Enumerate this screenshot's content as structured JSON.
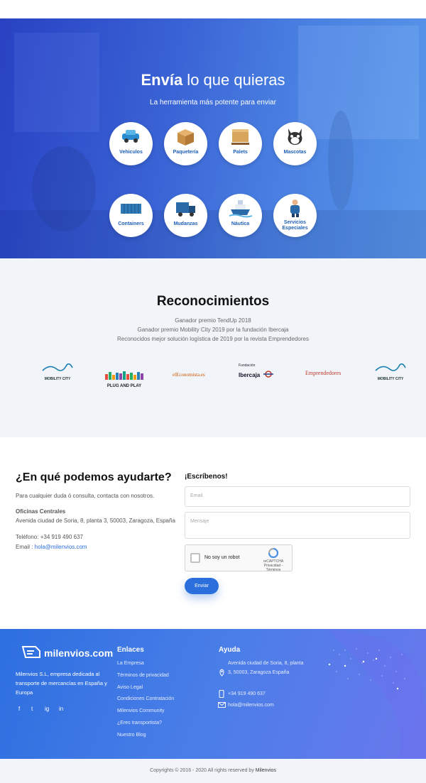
{
  "hero": {
    "title_bold": "Envía",
    "title_rest": " lo que quieras",
    "subtitle": "La herramienta más potente para enviar",
    "categories": [
      {
        "label": "Vehiculos",
        "icon": "car-icon"
      },
      {
        "label": "Paquetería",
        "icon": "box-icon"
      },
      {
        "label": "Palets",
        "icon": "pallet-icon"
      },
      {
        "label": "Mascotas",
        "icon": "cat-icon"
      },
      {
        "label": "Containers",
        "icon": "container-icon"
      },
      {
        "label": "Mudanzas",
        "icon": "truck-icon"
      },
      {
        "label": "Náutica",
        "icon": "ship-icon"
      },
      {
        "label": "Servicios Especiales",
        "icon": "worker-icon"
      }
    ]
  },
  "recognitions": {
    "title": "Reconocimientos",
    "lines": [
      "Ganador premio TendUp 2018",
      "Ganador premio Mobility City 2019 por la fundación Ibercaja",
      "Reconocidos mejor solución logística de 2019 por la revista Emprendedores"
    ],
    "logos": {
      "mobility": "MOBILITY CITY",
      "plugandplay": "PLUG AND PLAY",
      "economista": "elEconomista.es",
      "ibercaja_top": "Fundación",
      "ibercaja_bottom": "Ibercaja",
      "emprendedores": "Emprendedores"
    }
  },
  "contact": {
    "title": "¿En qué podemos ayudarte?",
    "intro": "Para cualquier duda ó consulta, contacta con nosotros.",
    "office_label": "Oficinas Centrales",
    "office_address": "Avenida ciudad de Soria, 8, planta 3, 50003, Zaragoza, España",
    "phone": "Teléfono: +34 919 490 637",
    "email_label": "Email : ",
    "email": "hola@milenvios.com",
    "form_title": "¡Escríbenos!",
    "email_placeholder": "Email",
    "message_placeholder": "Mensaje",
    "captcha_label": "No soy un robot",
    "captcha_brand": "reCAPTCHA",
    "captcha_links": "Privacidad - Términos",
    "send": "Enviar"
  },
  "footer": {
    "brand": "milenvios.com",
    "description": "Milenvios S.L, empresa dedicada al transporte de mercancías en España y Europa",
    "social": [
      "f",
      "t",
      "ig",
      "in"
    ],
    "links_title": "Enlaces",
    "links": [
      "La Empresa",
      "Términos de privacidad",
      "Aviso Legal",
      "Condiciones Contratación",
      "Milenvios Community",
      "¿Eres transportista?",
      "Nuestro Blog"
    ],
    "help_title": "Ayuda",
    "address": "Avenida ciudad de Soria, 8, planta 3, 50003, Zaragoza España",
    "phone": "+34 919 490 637",
    "email": "hola@milenvios.com",
    "copyright": "Copyrights © 2016 - 2020 All rights reserved by ",
    "copyright_brand": "Milenvios"
  }
}
